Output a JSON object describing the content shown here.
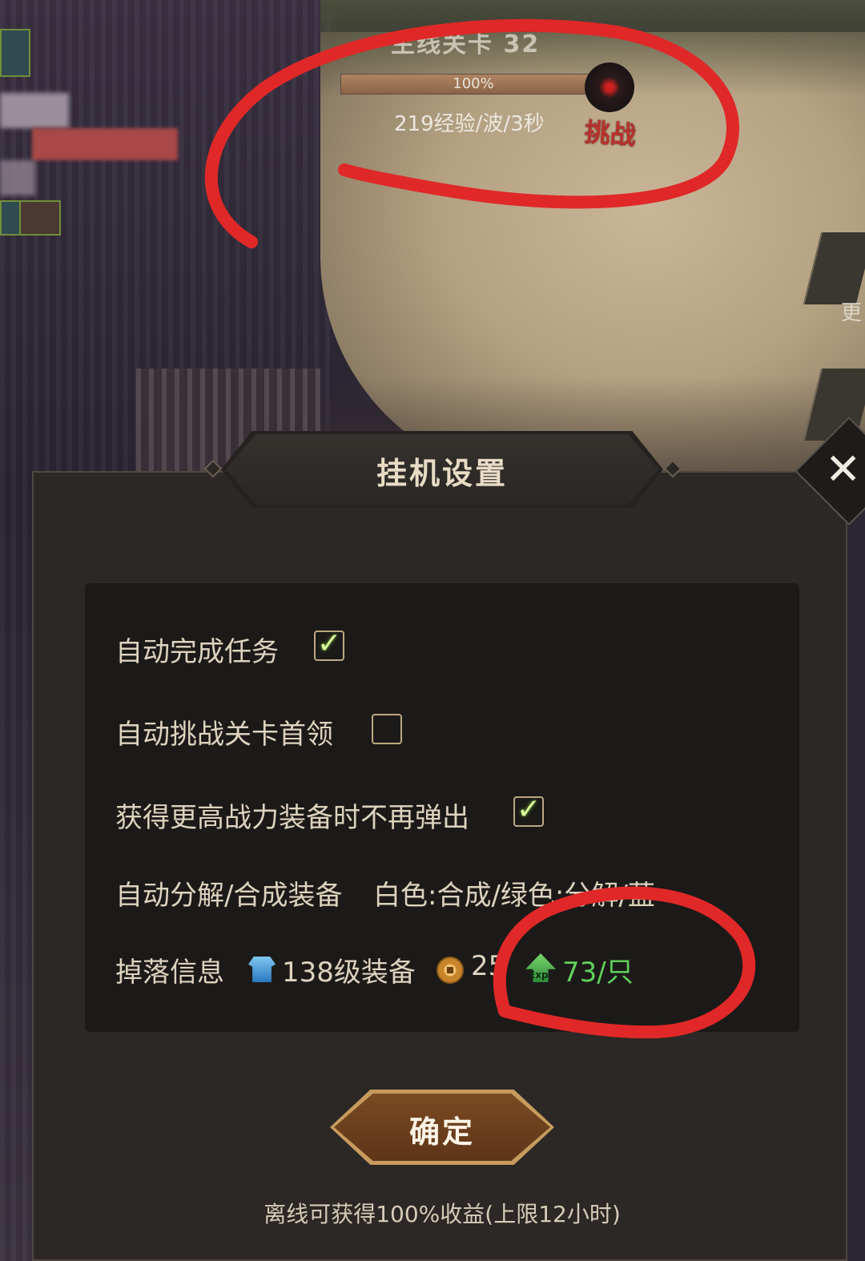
{
  "hud": {
    "stage_title": "主线关卡 32",
    "progress_percent": 100,
    "progress_label": "100%",
    "rate_text": "219经验/波/3秒",
    "challenge_label": "挑战",
    "right_label": "更"
  },
  "dialog": {
    "title": "挂机设置",
    "close_label": "✕",
    "options": [
      {
        "label": "自动完成任务",
        "checked": true
      },
      {
        "label": "自动挑战关卡首领",
        "checked": false
      },
      {
        "label": "获得更高战力装备时不再弹出",
        "checked": true
      }
    ],
    "auto_decompose": {
      "label": "自动分解/合成装备",
      "value": "白色:合成/绿色:分解/蓝"
    },
    "drops": {
      "label": "掉落信息",
      "equipment": "138级装备",
      "gold": "25",
      "exp": "73/只",
      "exp_icon_text": "Exp"
    },
    "confirm_label": "确定",
    "footer": "离线可获得100%收益(上限12小时)"
  },
  "colors": {
    "annotation": "#e02828",
    "checkbox_border": "#bba982",
    "tick": "#d8ff9a",
    "exp_green": "#5fd05a",
    "confirm_bg": "#6a3e1c"
  },
  "icons": [
    "armor-icon",
    "coin-icon",
    "exp-icon",
    "close-icon",
    "check-icon",
    "boss-icon"
  ]
}
